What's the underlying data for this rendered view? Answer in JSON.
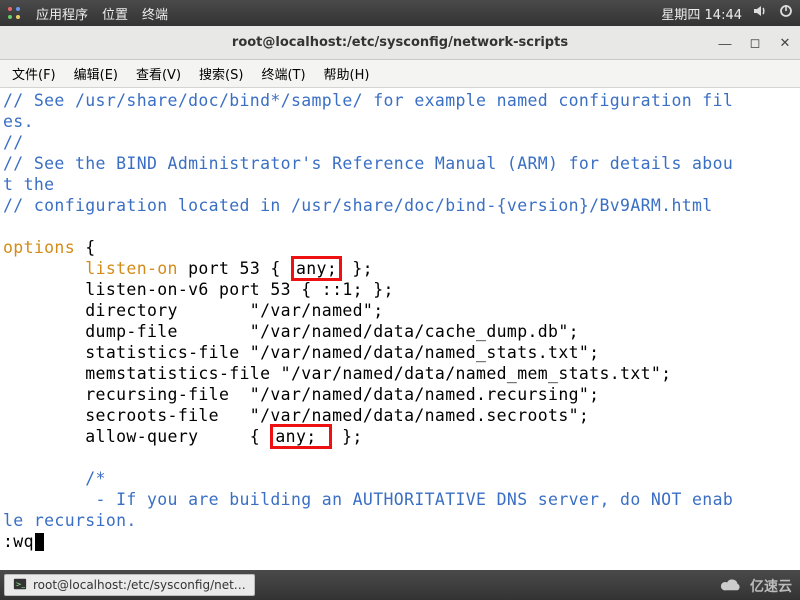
{
  "panel": {
    "apps": "应用程序",
    "places": "位置",
    "terminal": "终端",
    "clock": "星期四 14:44"
  },
  "window": {
    "title": "root@localhost:/etc/sysconfig/network-scripts"
  },
  "menubar": {
    "file": "文件(F)",
    "edit": "编辑(E)",
    "view": "查看(V)",
    "search": "搜索(S)",
    "terminal": "终端(T)",
    "help": "帮助(H)"
  },
  "content": {
    "l1": "// See /usr/share/doc/bind*/sample/ for example named configuration fil",
    "l1b": "es.",
    "l2": "//",
    "l3": "// See the BIND Administrator's Reference Manual (ARM) for details abou",
    "l3b": "t the",
    "l4": "// configuration located in /usr/share/doc/bind-{version}/Bv9ARM.html",
    "opts": "options",
    "brace_open": " {",
    "listen_kw": "listen-on",
    "listen_rest_a": " port 53 { ",
    "listen_any": "any;",
    "listen_rest_b": " };",
    "listen6": "        listen-on-v6 port 53 { ::1; };",
    "dir": "        directory       \"/var/named\";",
    "dump": "        dump-file       \"/var/named/data/cache_dump.db\";",
    "stats": "        statistics-file \"/var/named/data/named_stats.txt\";",
    "mem": "        memstatistics-file \"/var/named/data/named_mem_stats.txt\";",
    "rec": "        recursing-file  \"/var/named/data/named.recursing\";",
    "secr": "        secroots-file   \"/var/named/data/named.secroots\";",
    "aq_a": "        allow-query     { ",
    "aq_any": "any; ",
    "aq_b": " };",
    "cmt_open": "        /*",
    "cmt1a": "         - If you are building an AUTHORITATIVE DNS server, do NOT enab",
    "cmt1b": "le recursion.",
    "cmd": ":wq"
  },
  "taskbar": {
    "btn": "root@localhost:/etc/sysconfig/net…"
  },
  "watermark": "亿速云"
}
